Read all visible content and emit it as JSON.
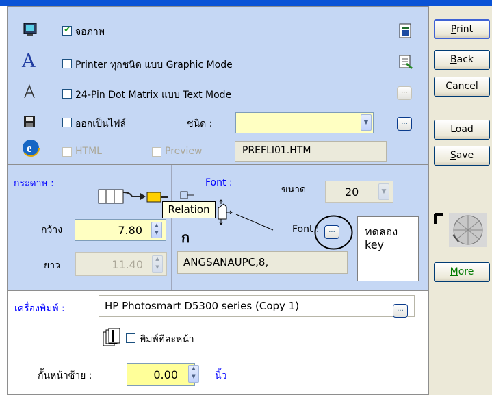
{
  "output": {
    "screen": {
      "label": "จอภาพ",
      "checked": true
    },
    "printer_graphic": {
      "label": "Printer ทุกชนิด แบบ Graphic Mode",
      "checked": false
    },
    "dot_matrix": {
      "label": "24-Pin Dot Matrix แบบ Text Mode",
      "checked": false
    },
    "export_file": {
      "label": "ออกเป็นไฟล์",
      "checked": false
    },
    "file_type_label": "ชนิด :",
    "file_type_value": "",
    "html": {
      "label": "HTML",
      "checked": false,
      "enabled": false
    },
    "preview": {
      "label": "Preview",
      "checked": false,
      "enabled": false
    },
    "filename": "PREFLI01.HTM"
  },
  "paper": {
    "title": "กระดาษ :",
    "width_label": "กว้าง",
    "width_value": "7.80",
    "height_label": "ยาว",
    "height_value": "11.40",
    "font_title": "Font :",
    "size_label": "ขนาด",
    "size_value": "20",
    "relation_tooltip": "Relation",
    "font_label": "Font :",
    "font_value": "ANGSANAUPC,8,",
    "sample_text": "ทดลอง\nkey",
    "dots": "..."
  },
  "printer": {
    "label": "เครื่องพิมพ์ :",
    "value": "HP Photosmart D5300 series (Copy 1)",
    "per_page_label": "พิมพ์ทีละหน้า",
    "per_page_checked": false,
    "margin_label": "กั้นหน้าซ้าย :",
    "margin_value": "0.00",
    "margin_unit": "นิ้ว"
  },
  "buttons": {
    "print": {
      "u": "P",
      "rest": "rint"
    },
    "back": {
      "u": "B",
      "rest": "ack"
    },
    "cancel": {
      "u": "C",
      "rest": "ancel"
    },
    "load": {
      "u": "L",
      "rest": "oad"
    },
    "save": {
      "u": "S",
      "rest": "ave"
    },
    "more": {
      "u": "M",
      "rest": "ore"
    }
  },
  "colors": {
    "panel_blue": "#c5d7f4",
    "accent_blue": "#0000ff",
    "input_yellow": "#ffffc2",
    "highlight_red": "#cc0000"
  }
}
